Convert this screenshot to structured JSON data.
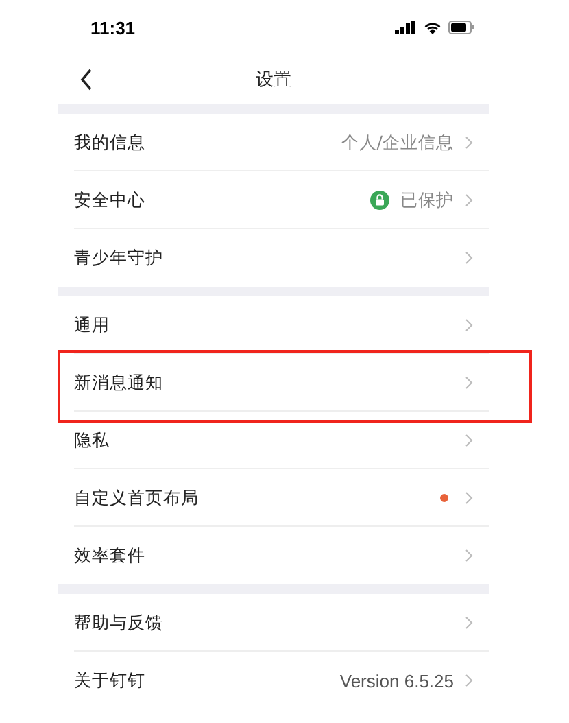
{
  "status_bar": {
    "time": "11:31"
  },
  "nav": {
    "title": "设置"
  },
  "sections": [
    {
      "rows": [
        {
          "label": "我的信息",
          "value": "个人/企业信息",
          "kind": "text",
          "highlighted": false
        },
        {
          "label": "安全中心",
          "value": "已保护",
          "kind": "shield",
          "highlighted": false
        },
        {
          "label": "青少年守护",
          "kind": "plain",
          "highlighted": false
        }
      ]
    },
    {
      "rows": [
        {
          "label": "通用",
          "kind": "plain",
          "highlighted": false
        },
        {
          "label": "新消息通知",
          "kind": "plain",
          "highlighted": true
        },
        {
          "label": "隐私",
          "kind": "plain",
          "highlighted": false
        },
        {
          "label": "自定义首页布局",
          "kind": "dot",
          "color": "#e8623a",
          "highlighted": false
        },
        {
          "label": "效率套件",
          "kind": "plain",
          "highlighted": false
        }
      ]
    },
    {
      "rows": [
        {
          "label": "帮助与反馈",
          "kind": "plain",
          "highlighted": false
        },
        {
          "label": "关于钉钉",
          "value": "Version 6.5.25",
          "kind": "version",
          "highlighted": false
        }
      ]
    }
  ]
}
